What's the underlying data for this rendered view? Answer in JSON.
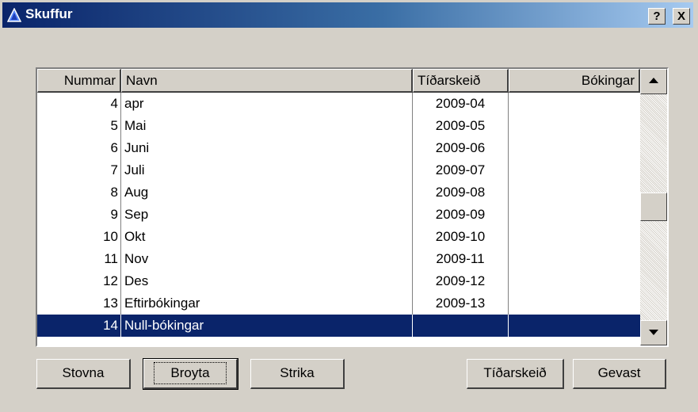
{
  "window": {
    "title": "Skuffur",
    "help_label": "?",
    "close_label": "X"
  },
  "columns": [
    "Nummar",
    "Navn",
    "Tíðarskeið",
    "Bókingar"
  ],
  "rows": [
    {
      "nummar": "4",
      "navn": "apr",
      "tidarskeid": "2009-04",
      "bokingar": ""
    },
    {
      "nummar": "5",
      "navn": "Mai",
      "tidarskeid": "2009-05",
      "bokingar": ""
    },
    {
      "nummar": "6",
      "navn": "Juni",
      "tidarskeid": "2009-06",
      "bokingar": ""
    },
    {
      "nummar": "7",
      "navn": "Juli",
      "tidarskeid": "2009-07",
      "bokingar": ""
    },
    {
      "nummar": "8",
      "navn": "Aug",
      "tidarskeid": "2009-08",
      "bokingar": ""
    },
    {
      "nummar": "9",
      "navn": "Sep",
      "tidarskeid": "2009-09",
      "bokingar": ""
    },
    {
      "nummar": "10",
      "navn": "Okt",
      "tidarskeid": "2009-10",
      "bokingar": ""
    },
    {
      "nummar": "11",
      "navn": "Nov",
      "tidarskeid": "2009-11",
      "bokingar": ""
    },
    {
      "nummar": "12",
      "navn": "Des",
      "tidarskeid": "2009-12",
      "bokingar": ""
    },
    {
      "nummar": "13",
      "navn": "Eftirbókingar",
      "tidarskeid": "2009-13",
      "bokingar": ""
    },
    {
      "nummar": "14",
      "navn": "Null-bókingar",
      "tidarskeid": "",
      "bokingar": "",
      "selected": true
    }
  ],
  "buttons": {
    "stovna": "Stovna",
    "broyta": "Broyta",
    "strika": "Strika",
    "tidarskeid": "Tíðarskeið",
    "gevast": "Gevast"
  },
  "icons": {
    "title": "app-triangle-icon",
    "scroll_up": "arrow-up-icon",
    "scroll_down": "arrow-down-icon"
  },
  "colors": {
    "title_start": "#0a246a",
    "title_end": "#a6caf0",
    "selection": "#0a246a",
    "face": "#d4d0c8"
  }
}
